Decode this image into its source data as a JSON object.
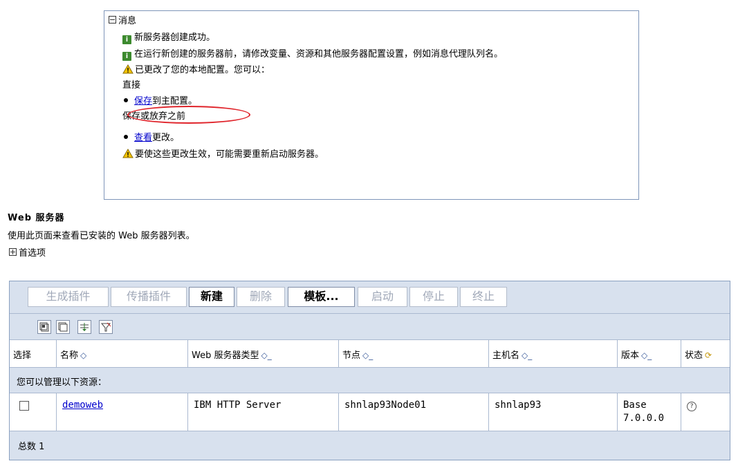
{
  "messages": {
    "title": "消息",
    "info_1": "新服务器创建成功。",
    "info_2": "在运行新创建的服务器前，请修改变量、资源和其他服务器配置设置，例如消息代理队列名。",
    "warn_1": "已更改了您的本地配置。您可以：",
    "direct_label": "直接",
    "save_link": "保存",
    "save_suffix": "到主配置。",
    "before_label": "保存或放弃之前",
    "review_link": "查看",
    "review_suffix": "更改。",
    "warn_2": "要使这些更改生效，可能需要重新启动服务器。"
  },
  "page": {
    "title": "Web 服务器",
    "description": "使用此页面来查看已安装的 Web 服务器列表。",
    "preferences": "首选项"
  },
  "toolbar": {
    "buttons": [
      {
        "label": "生成插件",
        "enabled": false
      },
      {
        "label": "传播插件",
        "enabled": false
      },
      {
        "label": "新建",
        "enabled": true
      },
      {
        "label": "删除",
        "enabled": false
      },
      {
        "label": "模板...",
        "enabled": true
      },
      {
        "label": "启动",
        "enabled": false
      },
      {
        "label": "停止",
        "enabled": false
      },
      {
        "label": "终止",
        "enabled": false
      }
    ],
    "icons": [
      "select-all-icon",
      "deselect-all-icon",
      "show-filter-icon",
      "clear-filter-icon"
    ]
  },
  "table": {
    "headers": [
      "选择",
      "名称",
      "Web 服务器类型",
      "节点",
      "主机名",
      "版本",
      "状态"
    ],
    "group_label": "您可以管理以下资源：",
    "rows": [
      {
        "name": "demoweb",
        "type": "IBM HTTP Server",
        "node": "shnlap93Node01",
        "host": "shnlap93",
        "version_line1": "Base",
        "version_line2": "7.0.0.0",
        "status": "unknown"
      }
    ],
    "total_label": "总数 1"
  },
  "colors": {
    "toolbar_bg": "#d8e1ee",
    "border": "#7e95b9",
    "link": "#0000cc",
    "highlight_oval": "#e0242b",
    "info_icon": "#3c8a2e",
    "warn_icon": "#f5c400"
  }
}
